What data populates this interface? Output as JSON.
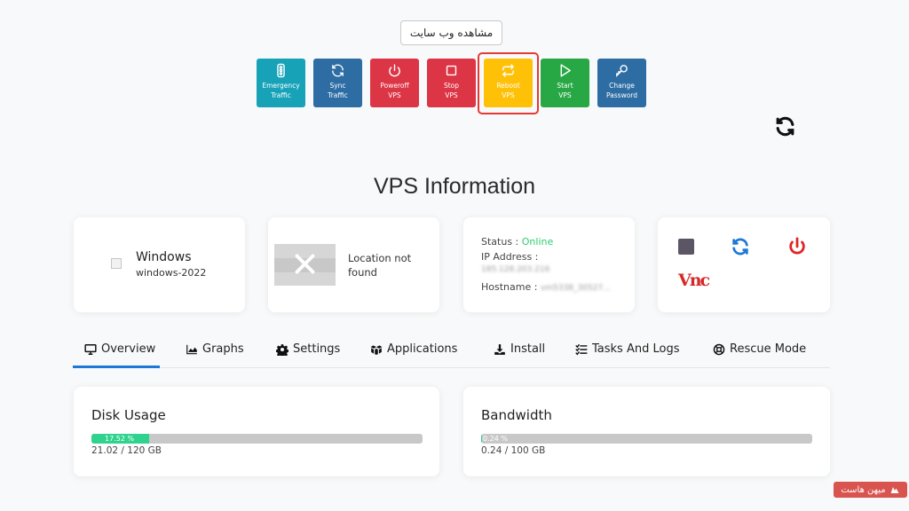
{
  "header": {
    "view_site_label": "مشاهده وب سایت"
  },
  "actions": [
    {
      "label": "Emergency\nTraffic",
      "icon": "traffic-light-icon",
      "color": "#17a2b8"
    },
    {
      "label": "Sync\nTraffic",
      "icon": "sync-icon",
      "color": "#2e6da4"
    },
    {
      "label": "Poweroff\nVPS",
      "icon": "power-icon",
      "color": "#dc3545"
    },
    {
      "label": "Stop\nVPS",
      "icon": "stop-icon",
      "color": "#dc3545"
    },
    {
      "label": "Reboot\nVPS",
      "icon": "reboot-icon",
      "color": "#ffc107"
    },
    {
      "label": "Start\nVPS",
      "icon": "play-icon",
      "color": "#28a745"
    },
    {
      "label": "Change\nPassword",
      "icon": "key-icon",
      "color": "#2e6da4"
    }
  ],
  "page_title": "VPS Information",
  "os_card": {
    "name": "Windows",
    "version": "windows-2022"
  },
  "location_card": {
    "text": "Location not found"
  },
  "info_card": {
    "status_label": "Status :",
    "status_value": "Online",
    "ip_label": "IP Address :",
    "ip_value": "185.128.203.216",
    "hostname_label": "Hostname :",
    "hostname_value": "vm5338_30527..."
  },
  "controls": {
    "stop_color": "#5c5566",
    "refresh_color": "#1e78d6",
    "power_color": "#e02424",
    "vnc_label": "Vnc"
  },
  "tabs": [
    {
      "label": "Overview",
      "icon": "monitor-icon",
      "active": true
    },
    {
      "label": "Graphs",
      "icon": "area-chart-icon",
      "active": false
    },
    {
      "label": "Settings",
      "icon": "gear-icon",
      "active": false
    },
    {
      "label": "Applications",
      "icon": "boxes-icon",
      "active": false
    },
    {
      "label": "Install",
      "icon": "download-icon",
      "active": false
    },
    {
      "label": "Tasks And Logs",
      "icon": "tasks-icon",
      "active": false
    },
    {
      "label": "Rescue Mode",
      "icon": "lifebuoy-icon",
      "active": false
    }
  ],
  "disk": {
    "title": "Disk Usage",
    "percent_label": "17.52 %",
    "percent": 17.52,
    "usage": "21.02 / 120 GB"
  },
  "bandwidth": {
    "title": "Bandwidth",
    "percent_label": "0.24 %",
    "percent": 0.24,
    "usage": "0.24 / 100 GB"
  },
  "watermark": {
    "text": "میهن هاست"
  }
}
